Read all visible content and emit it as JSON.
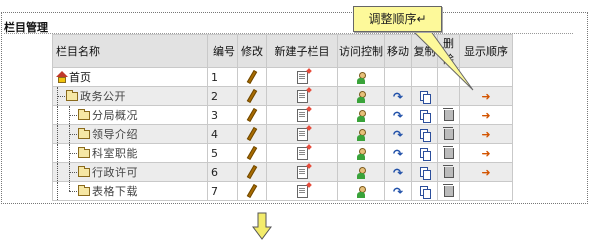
{
  "panel": {
    "title": "栏目管理"
  },
  "table": {
    "headers": [
      "栏目名称",
      "编号",
      "修改",
      "新建子栏目",
      "访问控制",
      "移动",
      "复制",
      "删除",
      "显示顺序"
    ],
    "rows": [
      {
        "name": "首页",
        "num": "1"
      },
      {
        "name": "政务公开",
        "num": "2"
      },
      {
        "name": "分局概况",
        "num": "3"
      },
      {
        "name": "领导介绍",
        "num": "4"
      },
      {
        "name": "科室职能",
        "num": "5"
      },
      {
        "name": "行政许可",
        "num": "6"
      },
      {
        "name": "表格下载",
        "num": "7"
      }
    ]
  },
  "callout": {
    "text": "调整顺序↵"
  },
  "icons": {
    "edit": "pencil-icon",
    "new_sub": "new-document-icon",
    "access": "user-icon",
    "move": "move-icon",
    "copy": "copy-icon",
    "delete": "trash-icon",
    "order": "arrow-right-icon",
    "down": "arrow-down-icon"
  },
  "colors": {
    "callout_bg": "#fdf99a",
    "down_arrow": "#f3ec6b",
    "header_bg": "#e2e2e2"
  }
}
